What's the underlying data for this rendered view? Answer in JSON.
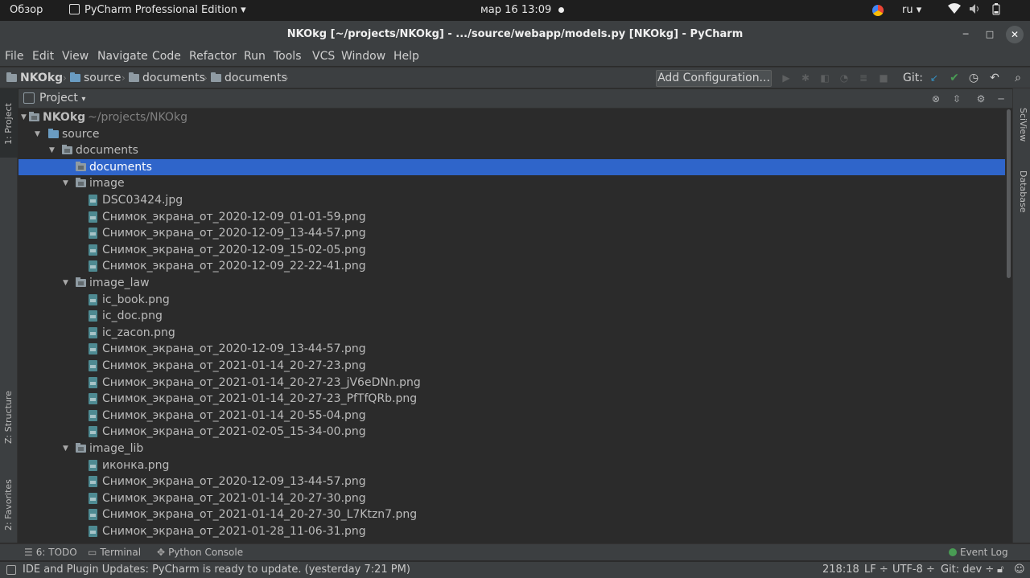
{
  "system_bar": {
    "overview": "Обзор",
    "app_name": "PyCharm Professional Edition",
    "clock": "мар 16  13:09",
    "language": "ru"
  },
  "window": {
    "title": "NKOkg [~/projects/NKOkg] - .../source/webapp/models.py [NKOkg] - PyCharm"
  },
  "menu": [
    "File",
    "Edit",
    "View",
    "Navigate",
    "Code",
    "Refactor",
    "Run",
    "Tools",
    "VCS",
    "Window",
    "Help"
  ],
  "breadcrumbs": [
    "NKOkg",
    "source",
    "documents",
    "documents"
  ],
  "toolbar": {
    "add_configuration": "Add Configuration...",
    "git_label": "Git:"
  },
  "side_tabs": {
    "project": "1: Project",
    "structure": "Z: Structure",
    "favorites": "2: Favorites",
    "sciview": "SciView",
    "database": "Database"
  },
  "panel": {
    "title": "Project"
  },
  "tree": [
    {
      "label": "NKOkg",
      "hint": "~/projects/NKOkg",
      "type": "root",
      "level": 0,
      "expanded": true
    },
    {
      "label": "source",
      "type": "folder",
      "level": 1,
      "expanded": true
    },
    {
      "label": "documents",
      "type": "folder",
      "level": 2,
      "expanded": true
    },
    {
      "label": "documents",
      "type": "folder",
      "level": 3,
      "selected": true
    },
    {
      "label": "image",
      "type": "folder",
      "level": 3,
      "expanded": true
    },
    {
      "label": "DSC03424.jpg",
      "type": "file",
      "level": 4
    },
    {
      "label": "Снимок_экрана_от_2020-12-09_01-01-59.png",
      "type": "file",
      "level": 4
    },
    {
      "label": "Снимок_экрана_от_2020-12-09_13-44-57.png",
      "type": "file",
      "level": 4
    },
    {
      "label": "Снимок_экрана_от_2020-12-09_15-02-05.png",
      "type": "file",
      "level": 4
    },
    {
      "label": "Снимок_экрана_от_2020-12-09_22-22-41.png",
      "type": "file",
      "level": 4
    },
    {
      "label": "image_law",
      "type": "folder",
      "level": 3,
      "expanded": true
    },
    {
      "label": "ic_book.png",
      "type": "file",
      "level": 4
    },
    {
      "label": "ic_doc.png",
      "type": "file",
      "level": 4
    },
    {
      "label": "ic_zacon.png",
      "type": "file",
      "level": 4
    },
    {
      "label": "Снимок_экрана_от_2020-12-09_13-44-57.png",
      "type": "file",
      "level": 4
    },
    {
      "label": "Снимок_экрана_от_2021-01-14_20-27-23.png",
      "type": "file",
      "level": 4
    },
    {
      "label": "Снимок_экрана_от_2021-01-14_20-27-23_jV6eDNn.png",
      "type": "file",
      "level": 4
    },
    {
      "label": "Снимок_экрана_от_2021-01-14_20-27-23_PfTfQRb.png",
      "type": "file",
      "level": 4
    },
    {
      "label": "Снимок_экрана_от_2021-01-14_20-55-04.png",
      "type": "file",
      "level": 4
    },
    {
      "label": "Снимок_экрана_от_2021-02-05_15-34-00.png",
      "type": "file",
      "level": 4
    },
    {
      "label": "image_lib",
      "type": "folder",
      "level": 3,
      "expanded": true
    },
    {
      "label": "иконка.png",
      "type": "file",
      "level": 4
    },
    {
      "label": "Снимок_экрана_от_2020-12-09_13-44-57.png",
      "type": "file",
      "level": 4
    },
    {
      "label": "Снимок_экрана_от_2021-01-14_20-27-30.png",
      "type": "file",
      "level": 4
    },
    {
      "label": "Снимок_экрана_от_2021-01-14_20-27-30_L7Ktzn7.png",
      "type": "file",
      "level": 4
    },
    {
      "label": "Снимок_экрана_от_2021-01-28_11-06-31.png",
      "type": "file",
      "level": 4
    }
  ],
  "bottom_tabs": {
    "todo": "6: TODO",
    "terminal": "Terminal",
    "python_console": "Python Console",
    "event_log": "Event Log"
  },
  "status": {
    "message": "IDE and Plugin Updates: PyCharm is ready to update. (yesterday 7:21 PM)",
    "position": "218:18",
    "line_sep": "LF ÷",
    "encoding": "UTF-8 ÷",
    "branch": "Git: dev ÷"
  },
  "colors": {
    "selection": "#2f65ca",
    "background": "#2b2b2b",
    "chrome": "#3c3f41",
    "git_update": "#3592c4",
    "git_commit": "#499c54"
  }
}
